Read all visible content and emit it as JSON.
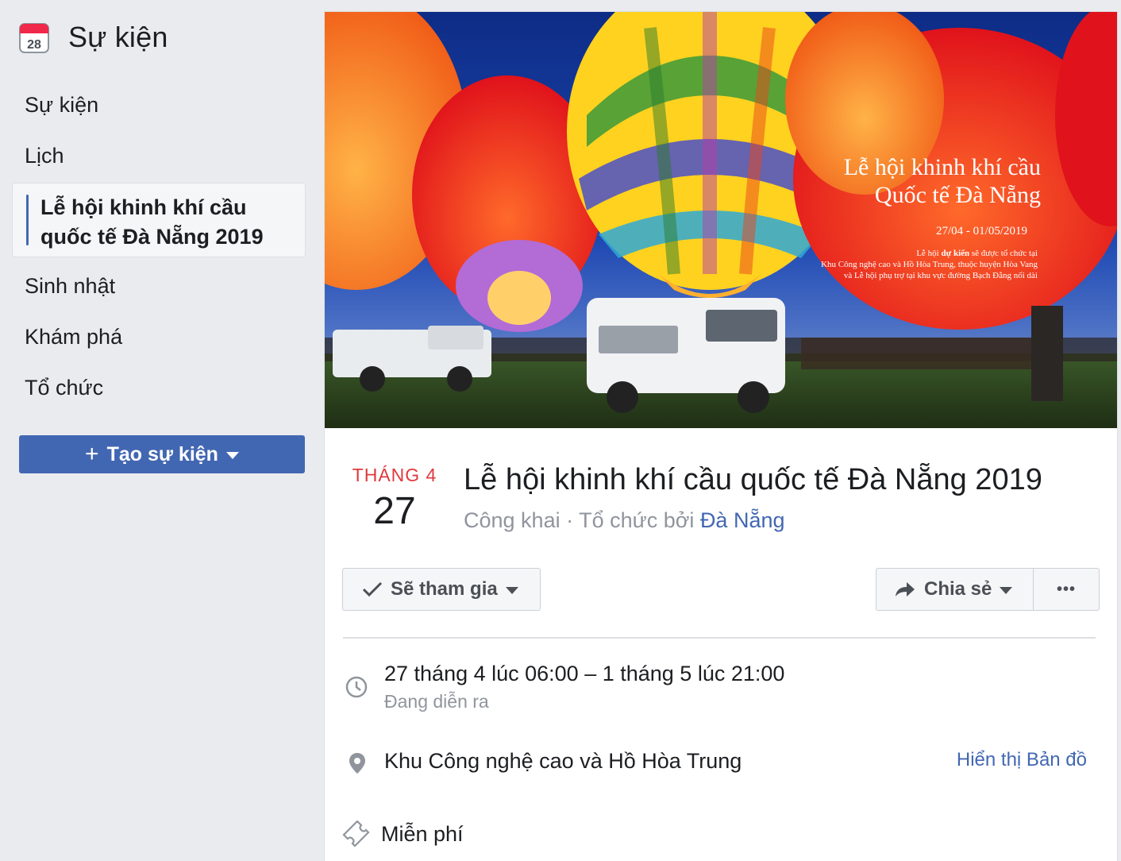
{
  "sidebar": {
    "calendar_icon_day": "28",
    "title": "Sự kiện",
    "items": [
      {
        "label": "Sự kiện"
      },
      {
        "label": "Lịch"
      },
      {
        "label": "Lễ hội khinh khí cầu quốc tế Đà Nẵng 2019",
        "line1": "Lễ hội khinh khí cầu",
        "line2": "quốc tế Đà Nẵng 2019",
        "active": true
      },
      {
        "label": "Sinh nhật"
      },
      {
        "label": "Khám phá"
      },
      {
        "label": "Tổ chức"
      }
    ],
    "create_button": {
      "icon": "plus-icon",
      "label": "Tạo sự kiện"
    }
  },
  "cover": {
    "line1": "Lễ hội khinh khí cầu",
    "line2": "Quốc tế Đà Nẵng",
    "dates": "27/04 - 01/05/2019",
    "note1_pre": "Lễ hội ",
    "note1_bold": "dự kiến",
    "note1_post": " sẽ được tổ chức tại",
    "note2": "Khu Công nghệ cao và Hồ Hòa Trung, thuộc huyện Hòa Vang",
    "note3": "và Lễ hội phụ trợ tại khu vực đường Bạch Đằng nối dài"
  },
  "event": {
    "month": "THÁNG 4",
    "day": "27",
    "title": "Lễ hội khinh khí cầu quốc tế Đà Nẵng 2019",
    "privacy": "Công khai",
    "separator": " · ",
    "organized_by": "Tổ chức bởi ",
    "host": "Đà Nẵng"
  },
  "actions": {
    "going": {
      "icon": "check-icon",
      "label": "Sẽ tham gia"
    },
    "share": {
      "icon": "share-icon",
      "label": "Chia sẻ"
    },
    "more": {
      "icon": "more-icon",
      "label": "•••"
    }
  },
  "details": {
    "time": {
      "icon": "clock-icon",
      "text": "27 tháng 4 lúc 06:00 – 1 tháng 5 lúc 21:00",
      "status": "Đang diễn ra"
    },
    "location": {
      "icon": "location-pin-icon",
      "text": "Khu Công nghệ cao và Hồ Hòa Trung",
      "map_link": "Hiển thị Bản đồ"
    },
    "price": {
      "icon": "ticket-icon",
      "text": "Miễn phí"
    }
  },
  "colors": {
    "accent": "#4267b2",
    "month_red": "#e0393e",
    "muted": "#90949c",
    "bg": "#e9ebee"
  }
}
